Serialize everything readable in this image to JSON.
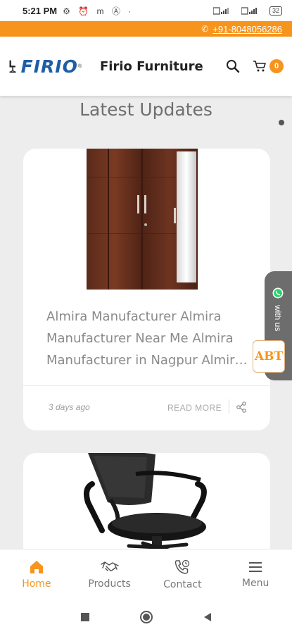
{
  "status": {
    "time": "5:21 PM",
    "left_icons": "⚙ ⏰ m Ⓐ ·",
    "battery": "32"
  },
  "top_strip": {
    "phone": "+91-8048056286"
  },
  "header": {
    "logo_text": "FIRIO",
    "logo_reg": "®",
    "brand_name": "Firio Furniture",
    "cart_count": "0"
  },
  "section": {
    "title": "Latest Updates"
  },
  "posts": [
    {
      "text": "Almira Manufacturer Almira Manufacturer Near Me Almira Manufacturer in Nagpur Almira Manufacturer",
      "date": "3 days ago",
      "read_more": "READ MORE"
    }
  ],
  "chat": {
    "label": "with us"
  },
  "badge": {
    "text": "ABT"
  },
  "bottom_nav": [
    {
      "label": "Home",
      "icon": "home-icon"
    },
    {
      "label": "Products",
      "icon": "handshake-icon"
    },
    {
      "label": "Contact",
      "icon": "phone-icon"
    },
    {
      "label": "Menu",
      "icon": "menu-icon"
    }
  ],
  "colors": {
    "accent": "#f7941d",
    "brand_blue": "#1d5fa6",
    "background": "#ededed"
  }
}
